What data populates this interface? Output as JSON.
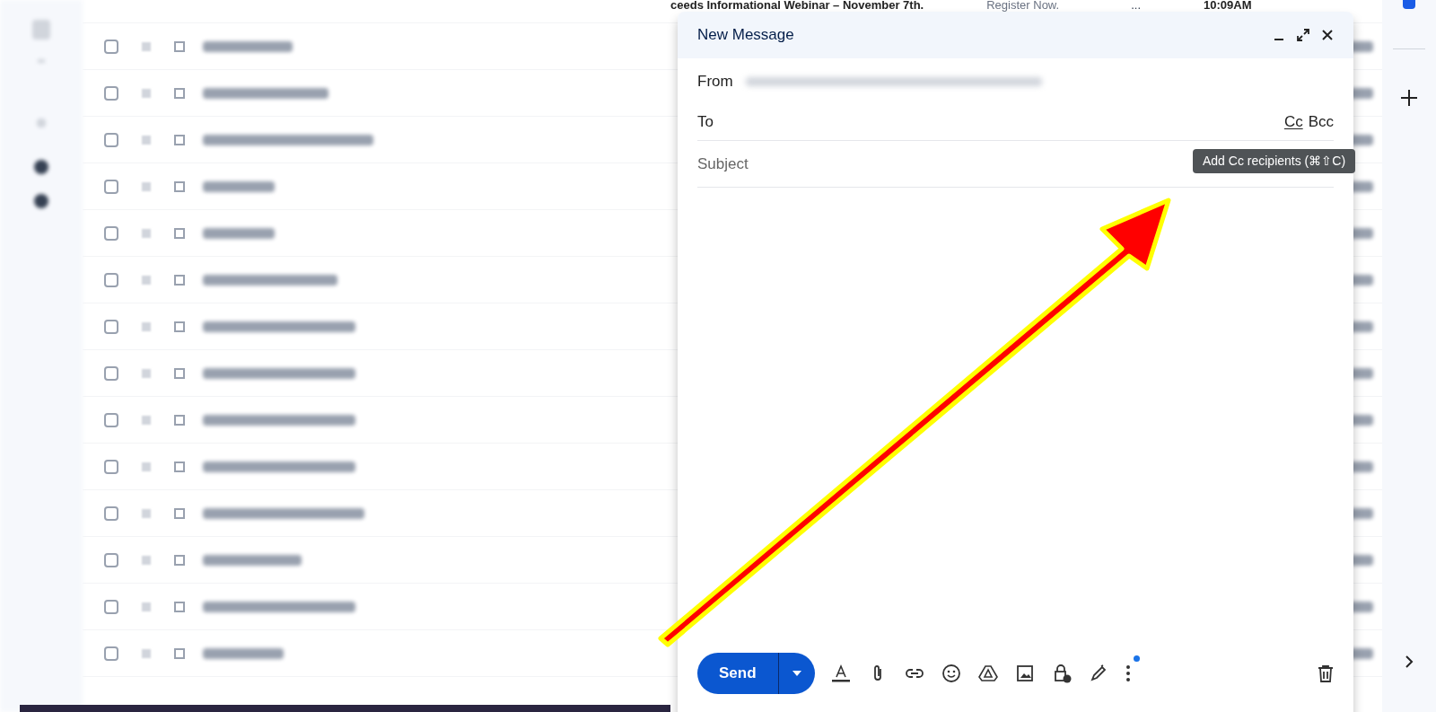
{
  "background_list": {
    "top_row": {
      "subject": "ceeds Informational Webinar – November 7th.",
      "snippet": "Register Now.",
      "more": "...",
      "time": "10:09AM"
    },
    "rows": [
      {
        "checked": false
      },
      {
        "checked": false
      },
      {
        "checked": false
      },
      {
        "checked": false
      },
      {
        "checked": false
      },
      {
        "checked": false
      },
      {
        "checked": false
      },
      {
        "checked": false
      },
      {
        "checked": false
      },
      {
        "checked": false
      },
      {
        "checked": false
      },
      {
        "checked": false
      },
      {
        "checked": false
      },
      {
        "checked": false
      }
    ]
  },
  "compose": {
    "title": "New Message",
    "from_label": "From",
    "to_label": "To",
    "cc": "Cc",
    "bcc": "Bcc",
    "subject_placeholder": "Subject",
    "send": "Send",
    "tooltip": "Add Cc recipients (⌘⇧C)",
    "more_options_dot": true
  }
}
